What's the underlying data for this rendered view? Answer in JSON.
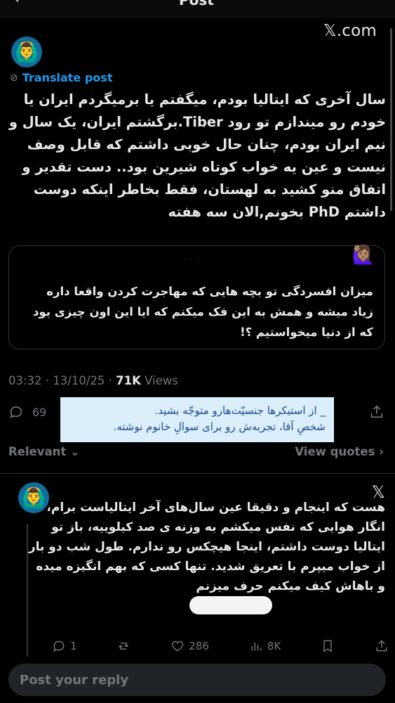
{
  "top": {
    "back_icon": "arrow-left-icon",
    "title": "Post"
  },
  "brand": {
    "label": "𝕏.com"
  },
  "post": {
    "translate_label": "Translate post",
    "text": "سال آخری که ایتالیا بودم، میگفتم یا برمیگردم ایران یا خودم رو میندازم تو رود Tiber.برگشتم ایران، یک سال و نیم ایران بودم، چنان حال خوبی داشتم که قابل وصف نیست و عین یه خواب کوتاه شیرین بود.. دست تقدیر و اتفاق منو کشید به لهستان، فقط بخاطر اینکه دوست داشتم PhD بخونم,الان سه هفته",
    "quote_text": "میزان افسردگی تو بچه هایی که مهاجرت کردن واقعا داره زیاد میشه و همش به این فک میکنم که ایا این اون چیزی بود که از دنیا میخواستیم ؟!",
    "time": "03:32 · 13/10/25 · ",
    "views_count": "71K",
    "views_label": " Views",
    "replies_count": "69"
  },
  "notice": {
    "line1": "_ از استیکرها جنسیّت‌هارو متوجّه بشید.",
    "line2": "شخصِ آقا، تجربه‌ش رو برای سوالِ خانوم نوشته."
  },
  "filters": {
    "relevant": "Relevant",
    "view_quotes": "View quotes"
  },
  "reply": {
    "text": "هست که اینجام و دقیقا عین سال‌های آخر ایتالیاست برام، انگار هوایی که نفس میکشم به وزنه ی صد کیلوییه، باز تو ایتالیا دوست داشتم، اینجا هیچکس رو ندارم. طول شب دو بار از خواب میپرم با تعریق شدید. تنها کسی که بهم انگیزه میده و باهاش کیف میکنم حرف میزنم",
    "replies": "1",
    "likes": "286",
    "views": "8K"
  },
  "composer": {
    "placeholder": "Post your reply"
  },
  "colors": {
    "accent": "#1d9bf0",
    "background": "#000000",
    "notice_bg": "#dbeefa"
  }
}
